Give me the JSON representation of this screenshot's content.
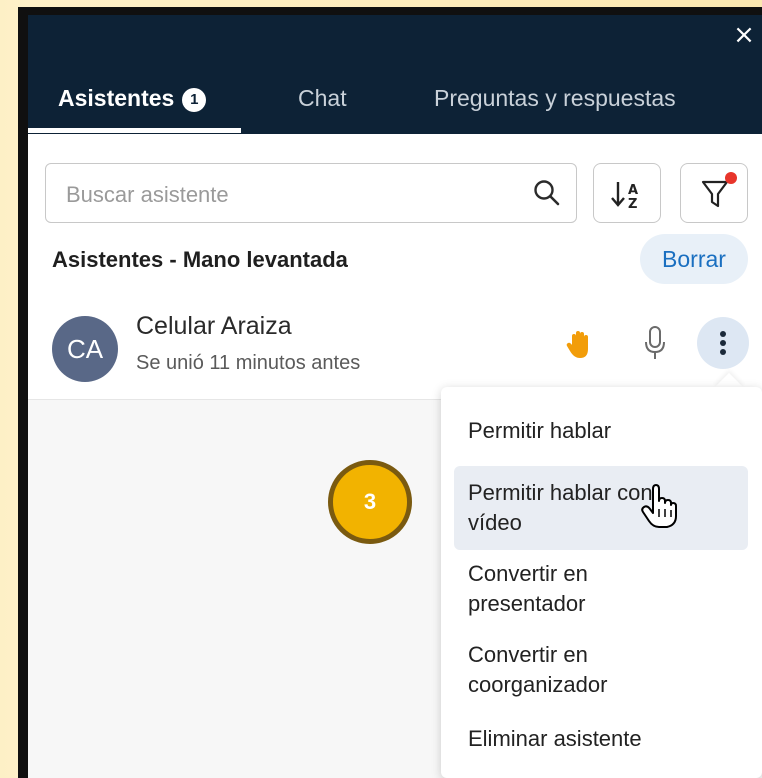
{
  "header": {
    "close_label": "×",
    "tabs": [
      {
        "label": "Asistentes",
        "badge": "1",
        "active": true
      },
      {
        "label": "Chat",
        "active": false
      },
      {
        "label": "Preguntas y respuestas",
        "active": false
      }
    ]
  },
  "search": {
    "placeholder": "Buscar asistente"
  },
  "section": {
    "title": "Asistentes - Mano levantada",
    "clear_label": "Borrar"
  },
  "attendee": {
    "initials": "CA",
    "name": "Celular Araiza",
    "status": "Se unió 11 minutos antes"
  },
  "menu": {
    "items": [
      {
        "label": "Permitir hablar"
      },
      {
        "label": "Permitir hablar con",
        "label2": "vídeo",
        "hover": true
      },
      {
        "label": "Convertir en",
        "label2": "presentador"
      },
      {
        "label": "Convertir en",
        "label2": "coorganizador"
      },
      {
        "label": "Eliminar asistente"
      }
    ]
  },
  "step": {
    "number": "3"
  },
  "colors": {
    "header": "#0d2236",
    "accent": "#1a6fc0",
    "hand": "#f29d0a",
    "step_badge": "#f2b300"
  },
  "icons": {
    "close": "close-icon",
    "search": "search-icon",
    "sort": "sort-az-icon",
    "filter": "filter-icon",
    "hand": "raised-hand-icon",
    "mic": "microphone-icon",
    "more": "more-vertical-icon",
    "cursor": "hand-pointer-cursor-icon"
  }
}
